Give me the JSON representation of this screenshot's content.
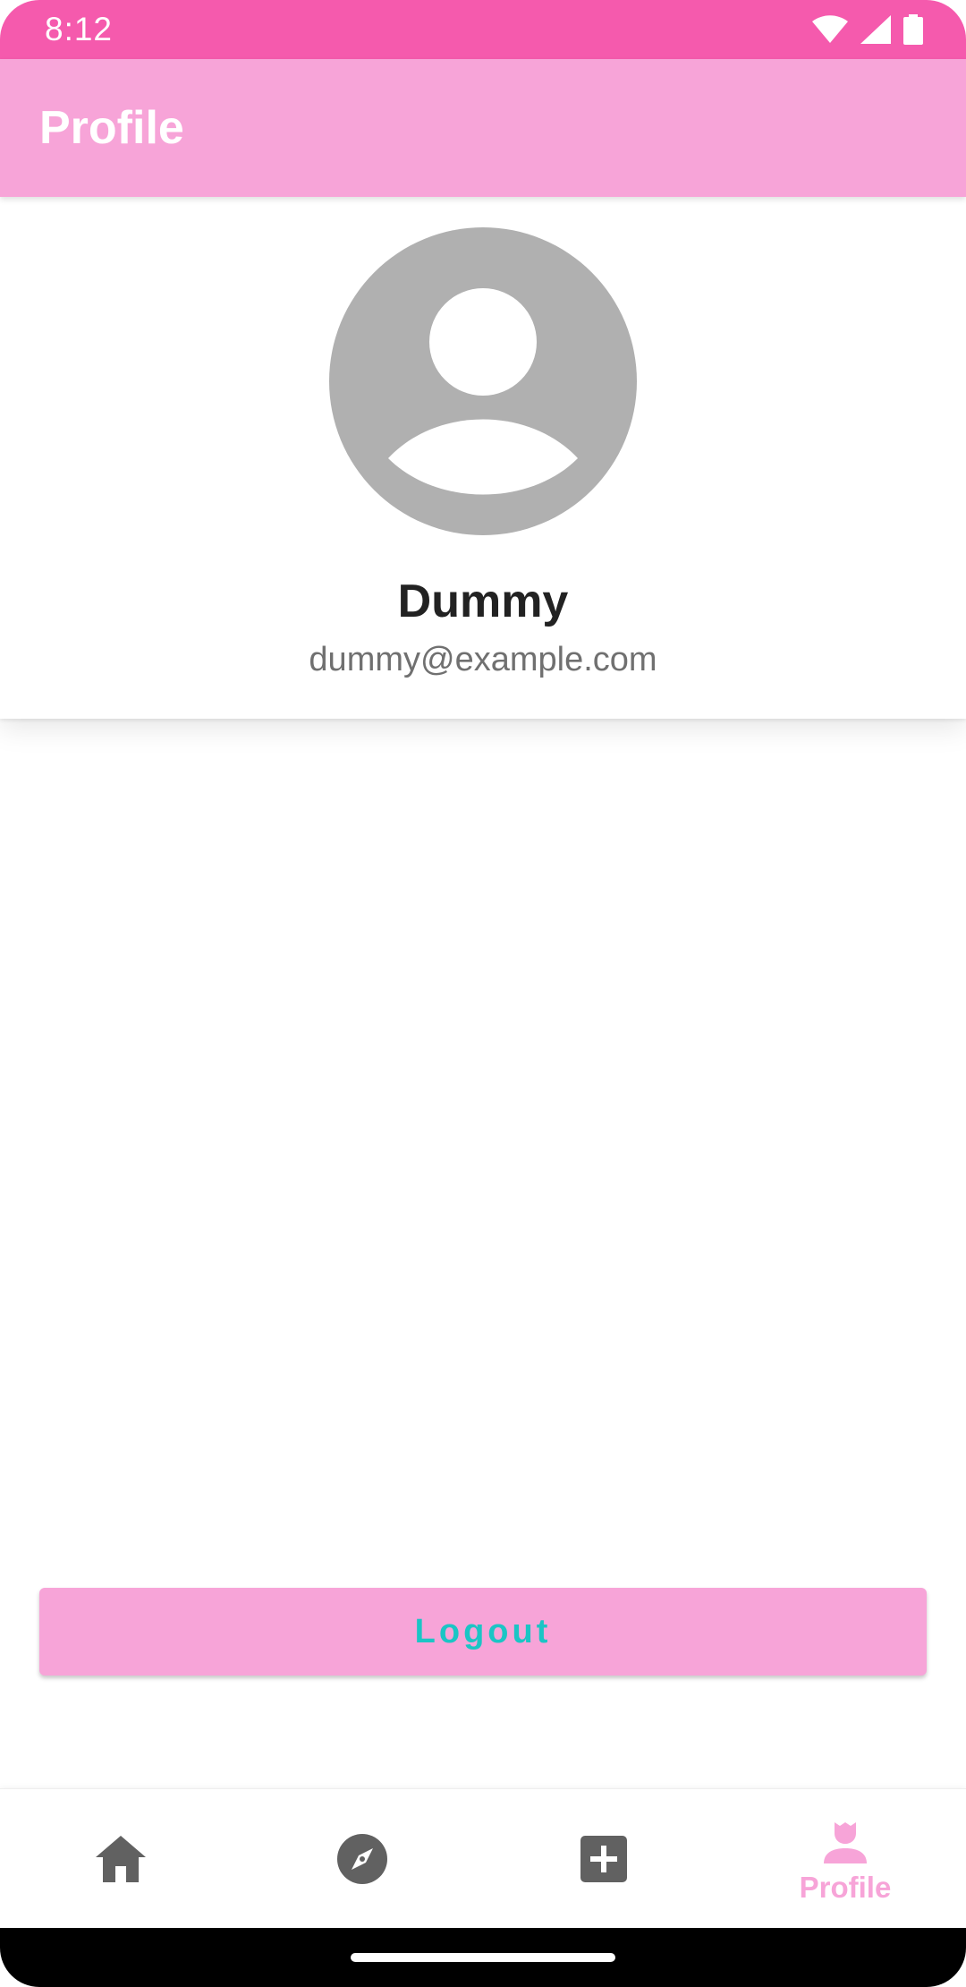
{
  "status_bar": {
    "time": "8:12",
    "icons": [
      "wifi-icon",
      "signal-icon",
      "battery-icon"
    ]
  },
  "app_bar": {
    "title": "Profile"
  },
  "profile": {
    "avatar_icon": "account-circle-icon",
    "name": "Dummy",
    "email": "dummy@example.com"
  },
  "logout_button": {
    "label": "Logout"
  },
  "bottom_nav": {
    "items": [
      {
        "id": "home",
        "icon": "home-icon",
        "label": "",
        "active": false
      },
      {
        "id": "explore",
        "icon": "compass-icon",
        "label": "",
        "active": false
      },
      {
        "id": "add",
        "icon": "add-box-icon",
        "label": "",
        "active": false
      },
      {
        "id": "profile",
        "icon": "person-icon",
        "label": "Profile",
        "active": true
      }
    ]
  },
  "colors": {
    "status_bar": "#f55aad",
    "primary": "#f7a4d8",
    "accent": "#1bc5c5",
    "avatar": "#b0b0b0",
    "inactive_icon": "#616161"
  }
}
